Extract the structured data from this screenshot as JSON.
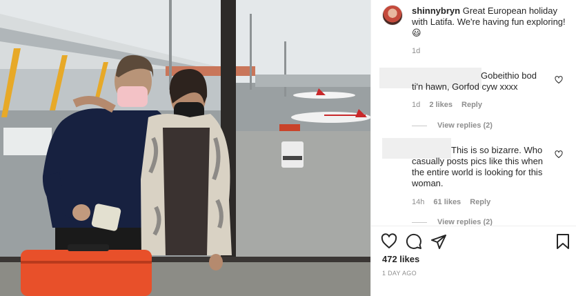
{
  "post": {
    "caption": {
      "username": "shinnybryn",
      "text": "Great European holiday with Latifa. We're having fun exploring! 😃",
      "time": "1d"
    },
    "comments": [
      {
        "text": "Gobeithio bod ti'n hawn, Gorfod cyw xxxx",
        "time": "1d",
        "likes": "2 likes",
        "reply_label": "Reply",
        "view_replies": "View replies (2)",
        "icon": "heart-outline-icon"
      },
      {
        "text": "This is so bizarre. Who casually posts pics like this when the entire world is looking for this woman.",
        "time": "14h",
        "likes": "61 likes",
        "reply_label": "Reply",
        "view_replies": "View replies (2)",
        "icon": "heart-outline-icon"
      }
    ],
    "actions": [
      "heart-icon",
      "comment-icon",
      "share-icon",
      "bookmark-icon"
    ],
    "likes_count": "472 likes",
    "time_ago": "1 DAY AGO"
  },
  "colors": {
    "text": "#262626",
    "secondary": "#8e8e8e",
    "luggage": "#e8502a"
  }
}
